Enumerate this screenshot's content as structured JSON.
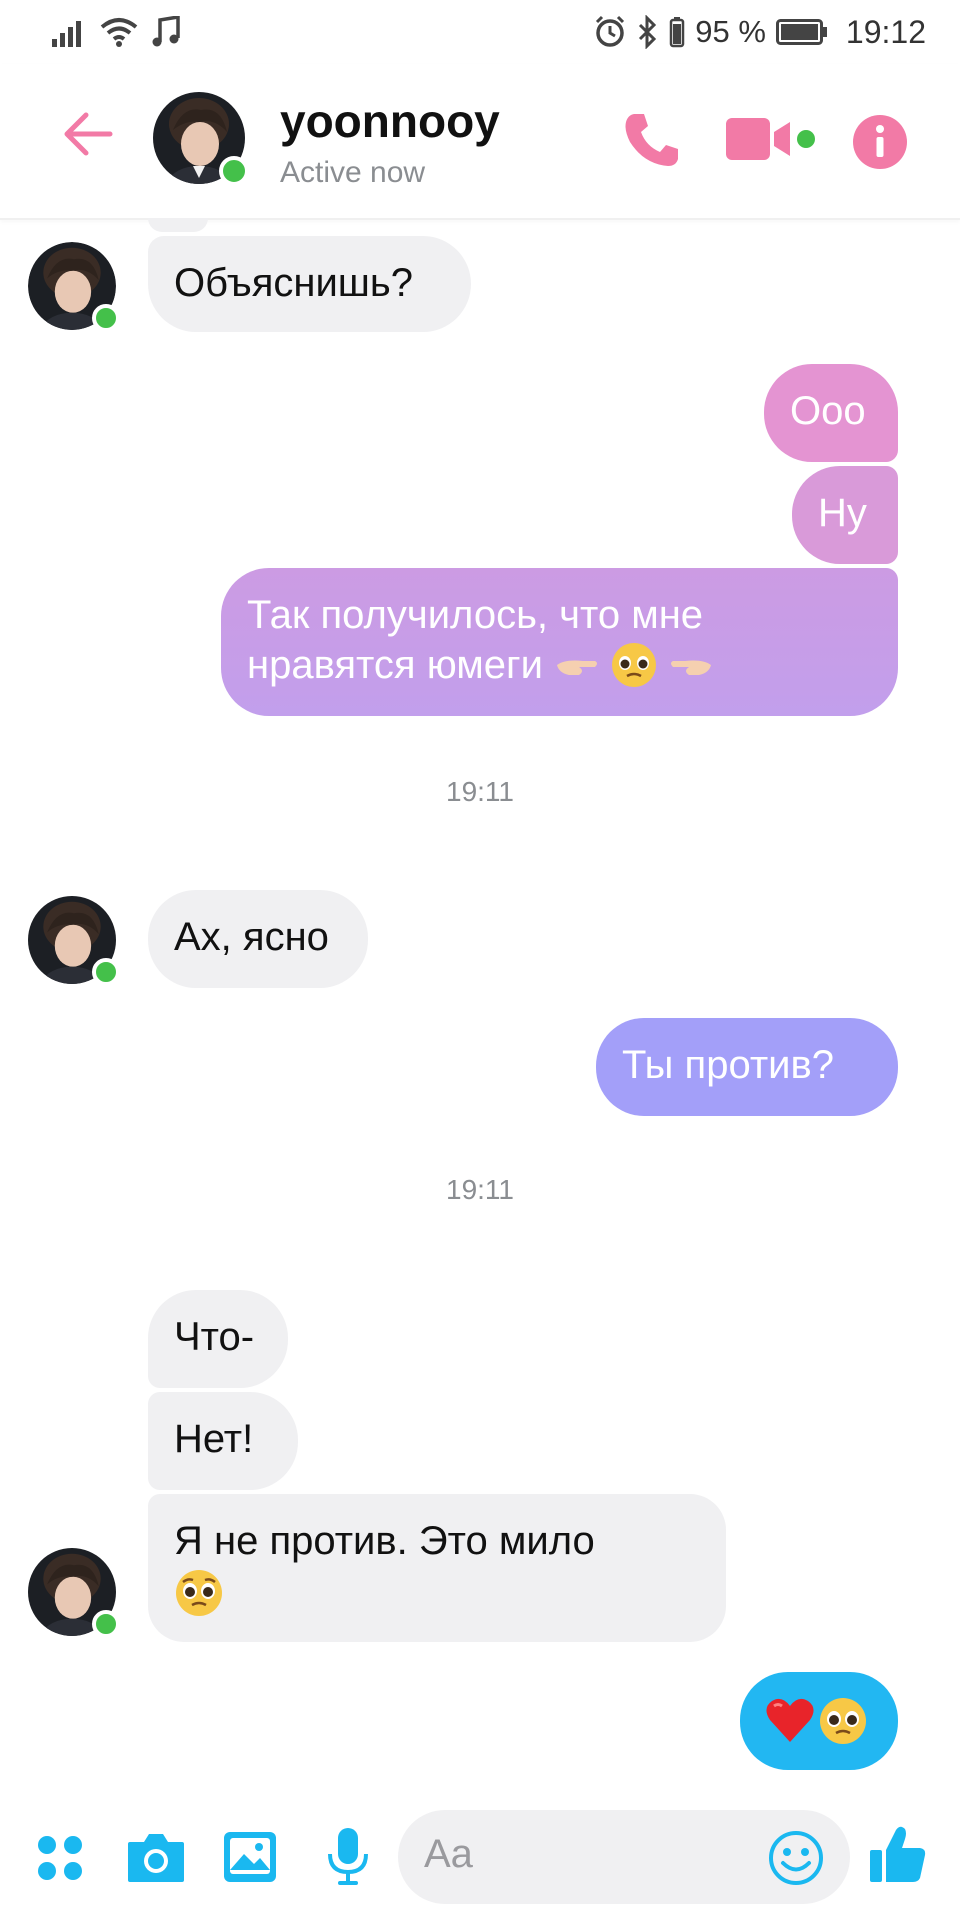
{
  "status_bar": {
    "battery_percent": "95 %",
    "time": "19:12"
  },
  "header": {
    "name": "yoonnooy",
    "status": "Active now"
  },
  "messages": [
    {
      "side": "in",
      "text": "Объяснишь?"
    },
    {
      "side": "out",
      "text": "Ооо"
    },
    {
      "side": "out",
      "text": "Ну"
    },
    {
      "side": "out",
      "line1": "Так получилось, что мне",
      "line2": "нравятся юмеги"
    },
    {
      "timestamp": "19:11"
    },
    {
      "side": "in",
      "text": "Ах, ясно"
    },
    {
      "side": "out",
      "text": "Ты против?"
    },
    {
      "timestamp": "19:11"
    },
    {
      "side": "in",
      "text": "Что-"
    },
    {
      "side": "in",
      "text": "Нет!"
    },
    {
      "side": "in",
      "text": "Я не против. Это мило"
    },
    {
      "side": "out",
      "emoji": [
        "red-heart",
        "pleading-face"
      ]
    }
  ],
  "composer": {
    "placeholder": "Aa"
  },
  "colors": {
    "accent_pink": "#f27aa6",
    "out_gradient_top": "#e690d2",
    "out_gradient_mid": "#c79ae6",
    "out_gradient_low": "#a89ff8",
    "out_blue": "#22b7f2",
    "composer_icon": "#1ab8f0",
    "online": "#44c04a"
  }
}
